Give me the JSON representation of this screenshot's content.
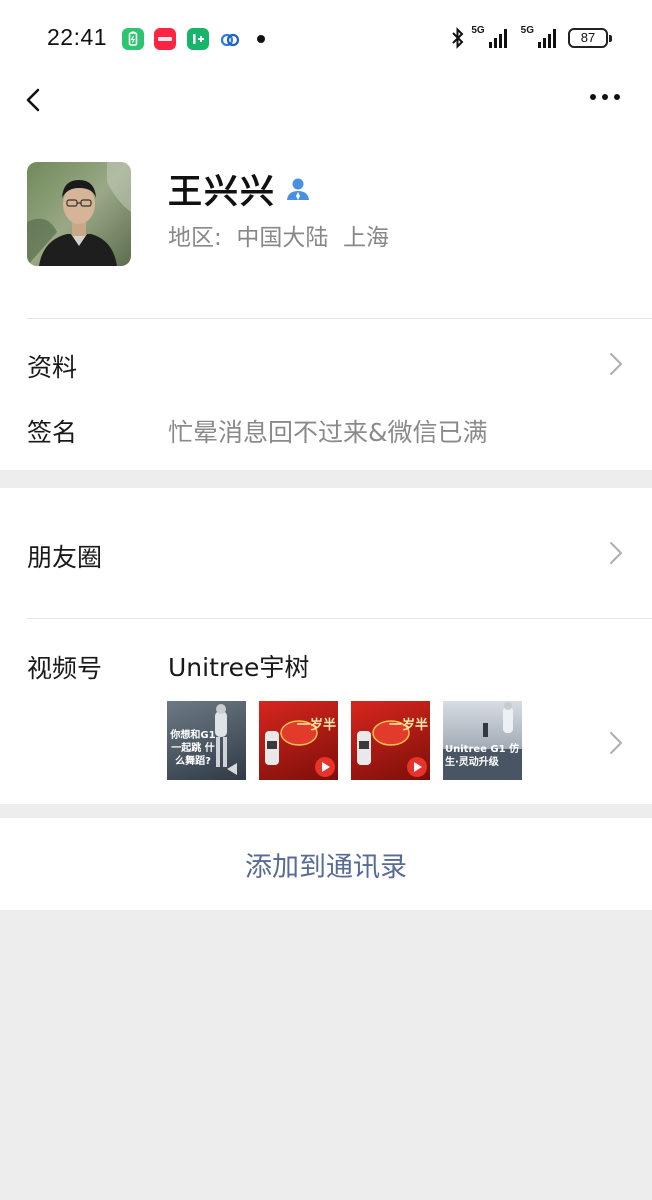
{
  "status_bar": {
    "time": "22:41",
    "app_icons": [
      "battery-saver-icon",
      "xiaohongshu-icon",
      "app-icon",
      "cloud-icon"
    ],
    "signal_1_label": "5G",
    "signal_2_label": "5G",
    "battery": "87"
  },
  "nav": {
    "back_icon": "chevron-left-icon",
    "more_icon": "more-icon"
  },
  "profile": {
    "name": "王兴兴",
    "region": "地区:  中国大陆  上海",
    "verified_icon": "user-verified-icon"
  },
  "info": {
    "profile_label": "资料",
    "signature_label": "签名",
    "signature_value": "忙晕消息回不过来&微信已满"
  },
  "moments": {
    "label": "朋友圈"
  },
  "channels": {
    "label": "视频号",
    "name": "Unitree宇树",
    "thumbnails": [
      {
        "caption": "你想和G1 一起跳 什么舞蹈?"
      },
      {
        "caption": "一岁半"
      },
      {
        "caption": "一岁半"
      },
      {
        "caption": "Unitree G1 仿生·灵动升级"
      }
    ]
  },
  "action": {
    "add_contact": "添加到通讯录"
  },
  "colors": {
    "link": "#576b95",
    "background": "#ededed",
    "secondary_text": "#888888"
  }
}
